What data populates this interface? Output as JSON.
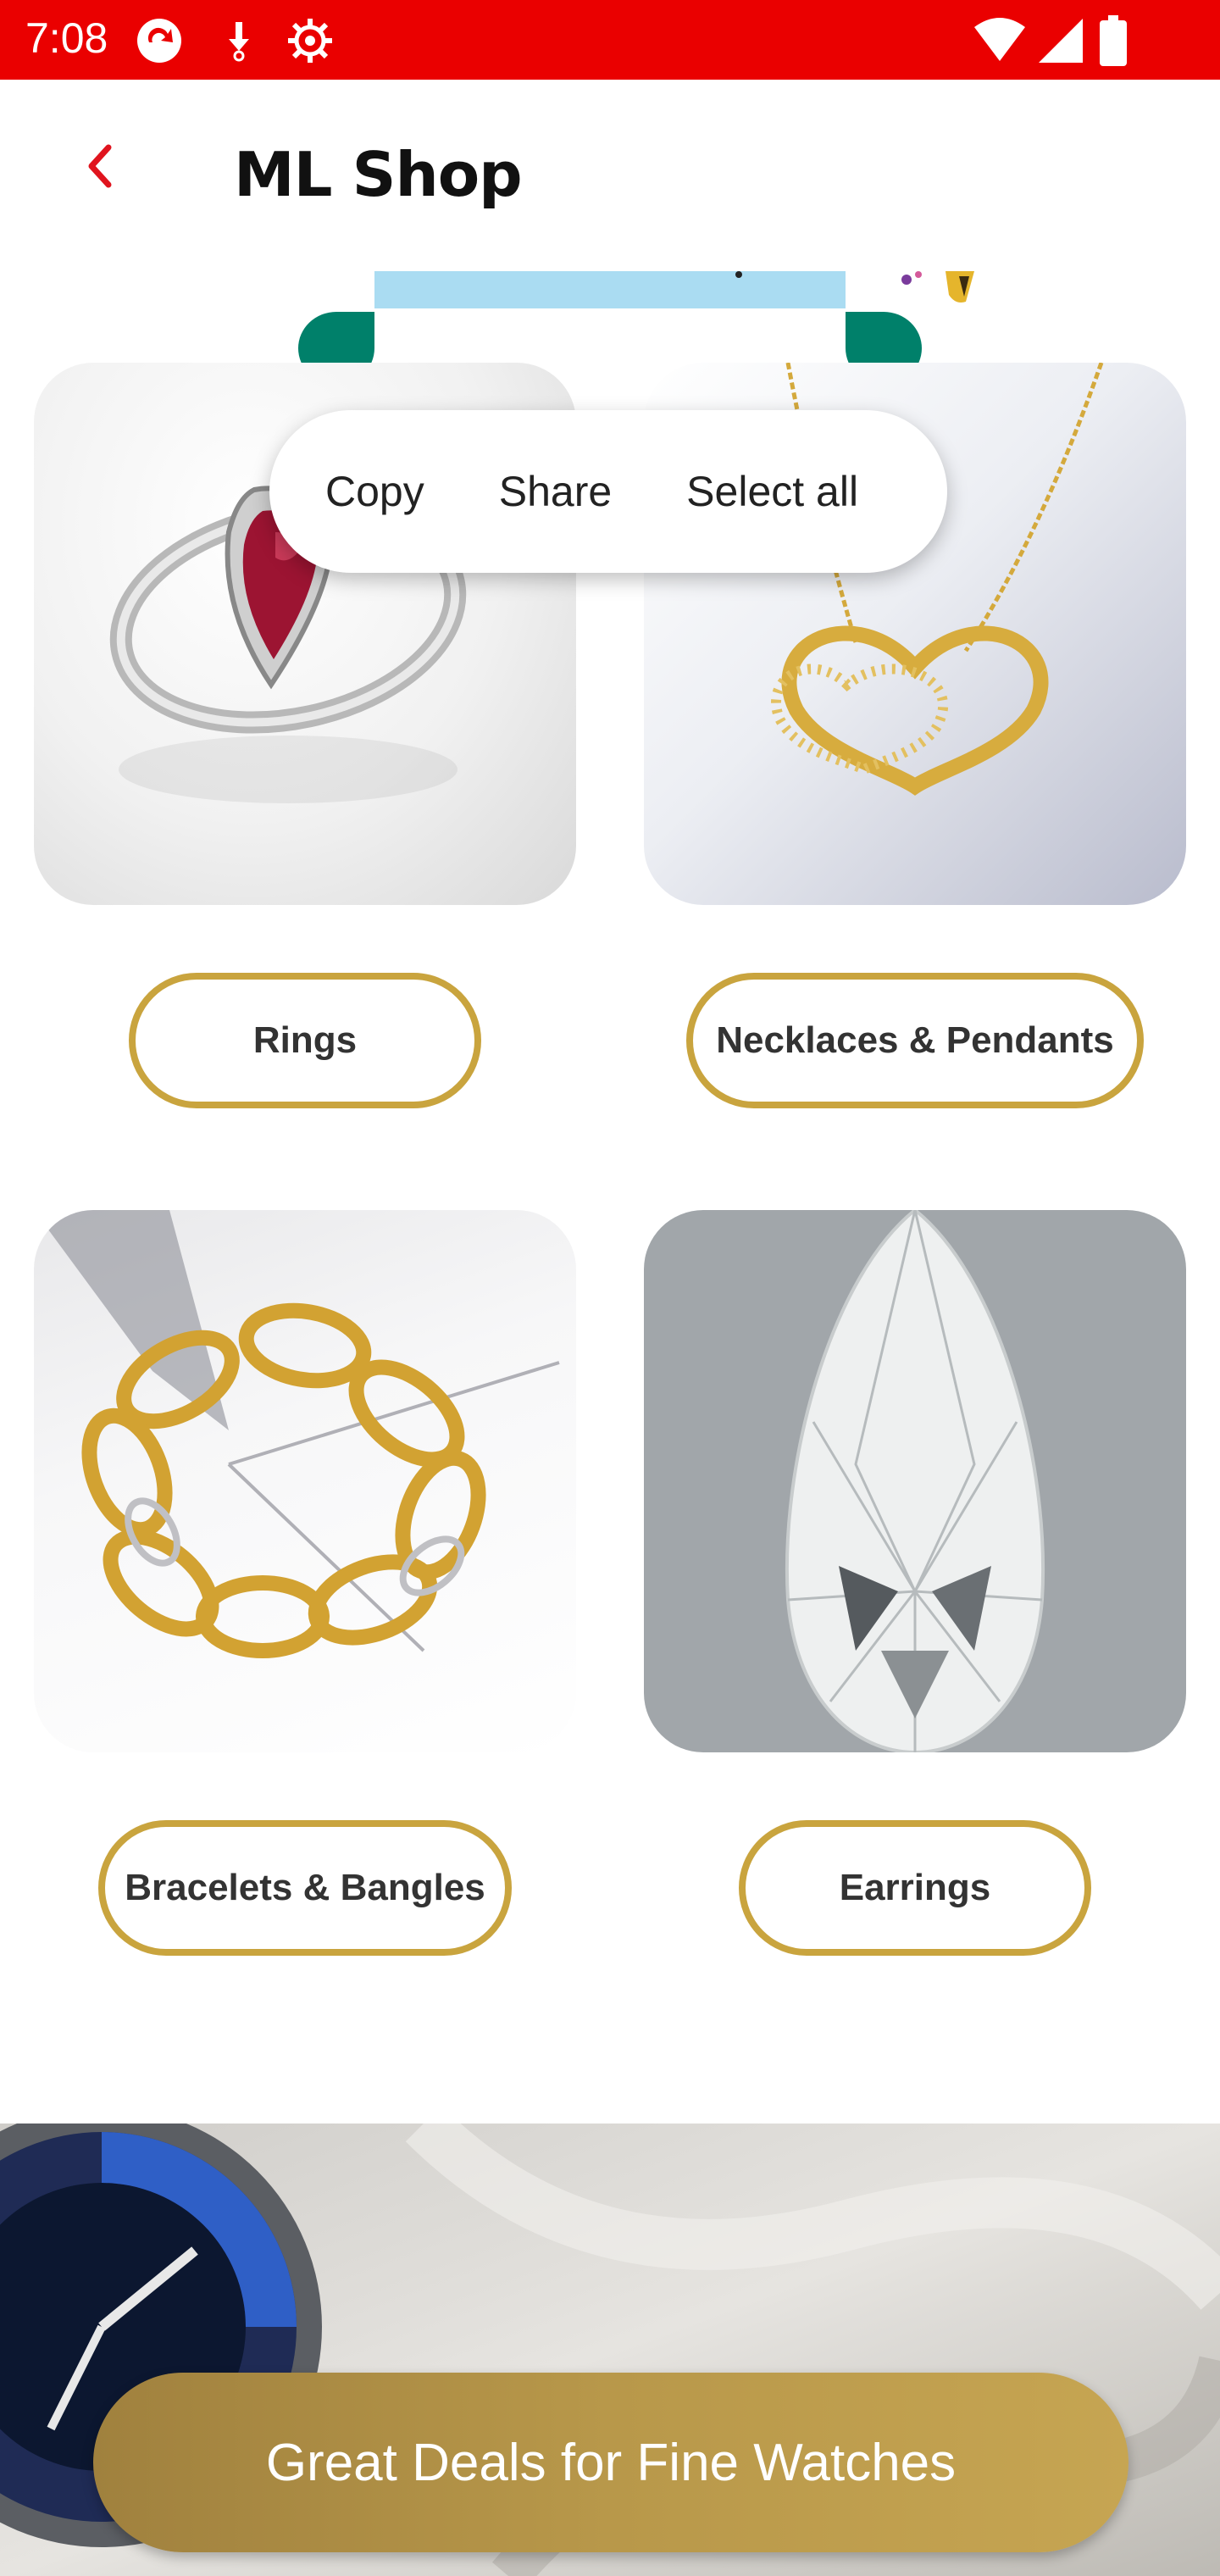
{
  "status_bar": {
    "time": "7:08",
    "icons_left": [
      "sync-icon",
      "download-icon",
      "settings-icon"
    ],
    "icons_right": [
      "wifi-icon",
      "signal-icon",
      "battery-icon"
    ]
  },
  "app_bar": {
    "title": "ML Shop",
    "back_icon": "chevron-left-icon"
  },
  "context_menu": {
    "items": [
      "Copy",
      "Share",
      "Select all"
    ]
  },
  "categories": [
    {
      "label": "Rings",
      "image": "ruby-ring"
    },
    {
      "label": "Necklaces & Pendants",
      "image": "heart-necklace"
    },
    {
      "label": "Bracelets & Bangles",
      "image": "gold-bracelet"
    },
    {
      "label": "Earrings",
      "image": "pear-diamond"
    }
  ],
  "banner": {
    "button_label": "Great Deals for Fine Watches",
    "image": "luxury-watch"
  },
  "colors": {
    "status_bar": "#ea0000",
    "accent_gold": "#c9a43e",
    "back_icon": "#e0141e",
    "selection_handle": "#00806a",
    "selection_highlight": "#aadcf2"
  }
}
